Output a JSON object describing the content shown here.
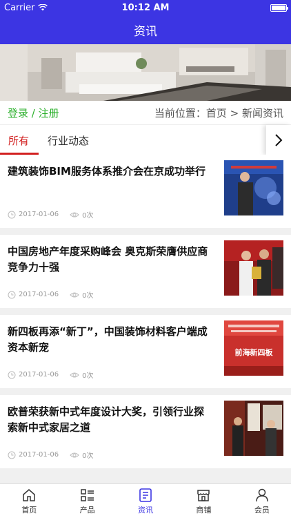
{
  "status": {
    "carrier": "Carrier",
    "time": "10:12 AM"
  },
  "nav": {
    "title": "资讯"
  },
  "crumb": {
    "login": "登录 / 注册",
    "location": "当前位置：首页 > 新闻资讯"
  },
  "tabs": [
    {
      "label": "所有",
      "active": true
    },
    {
      "label": "行业动态",
      "active": false
    }
  ],
  "news": [
    {
      "title": "建筑装饰BIM服务体系推介会在京成功举行",
      "date": "2017-01-06",
      "views": "0次",
      "thumb_text": ""
    },
    {
      "title": "中国房地产年度采购峰会 奥克斯荣膺供应商竞争力十强",
      "date": "2017-01-06",
      "views": "0次",
      "thumb_text": ""
    },
    {
      "title": "新四板再添“新丁”，中国装饰材料客户端成资本新宠",
      "date": "2017-01-06",
      "views": "0次",
      "thumb_text": "前海新四板"
    },
    {
      "title": "欧普荣获新中式年度设计大奖，引领行业探索新中式家居之道",
      "date": "2017-01-06",
      "views": "0次",
      "thumb_text": ""
    }
  ],
  "tab_bar": [
    {
      "label": "首页",
      "icon": "home-icon",
      "active": false
    },
    {
      "label": "产品",
      "icon": "product-list-icon",
      "active": false
    },
    {
      "label": "资讯",
      "icon": "news-icon",
      "active": true
    },
    {
      "label": "商铺",
      "icon": "shop-icon",
      "active": false
    },
    {
      "label": "会员",
      "icon": "user-icon",
      "active": false
    }
  ],
  "colors": {
    "primary": "#3c35e3",
    "tab_active": "#d22020",
    "login": "#2bb02b"
  }
}
